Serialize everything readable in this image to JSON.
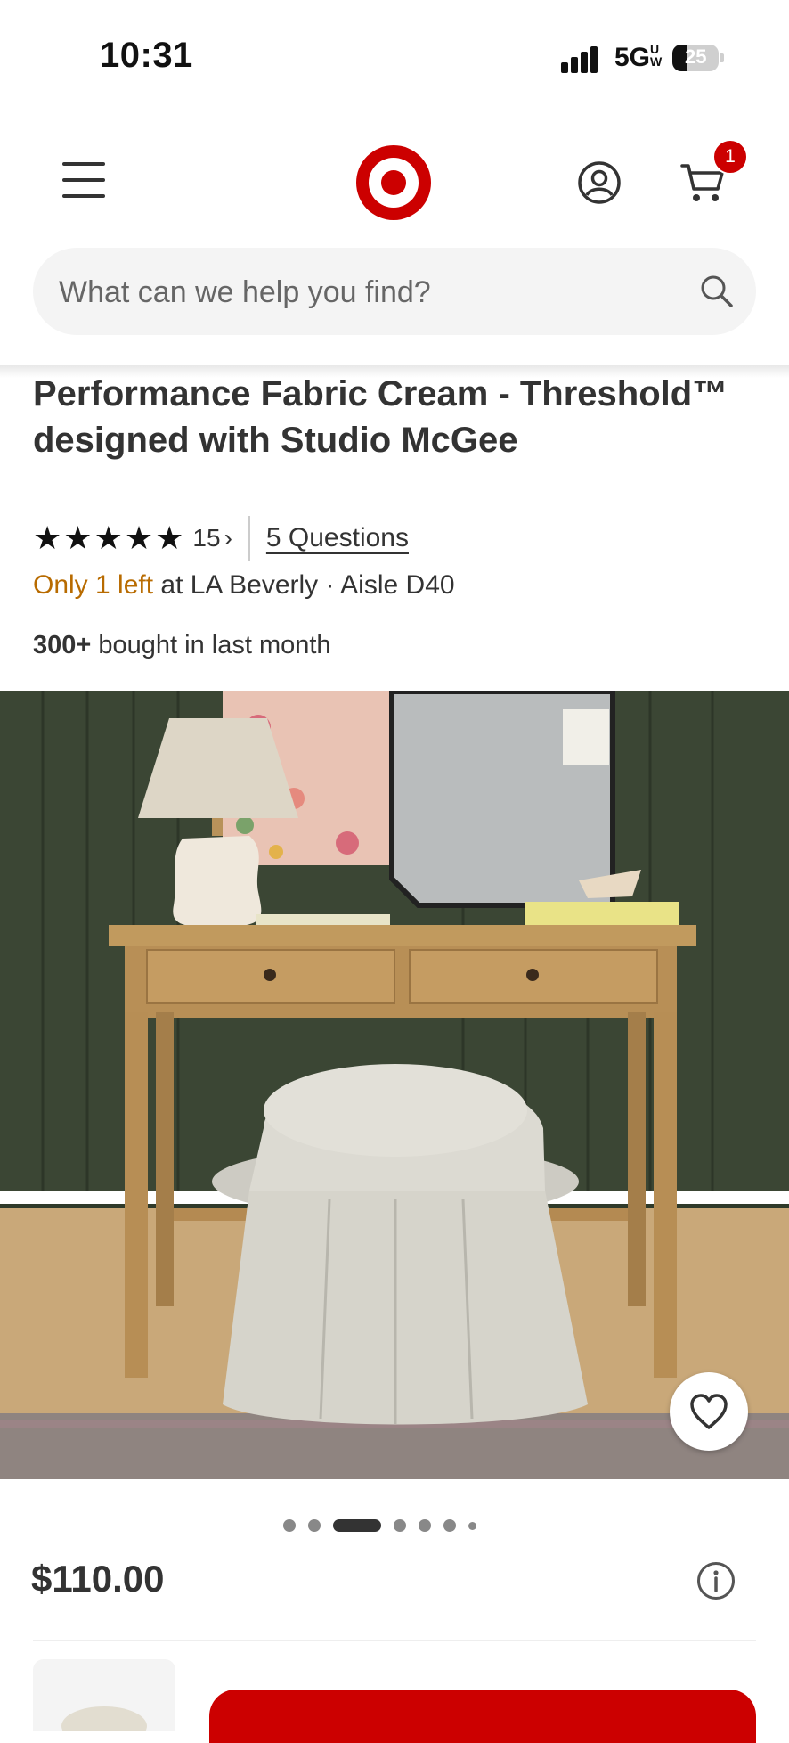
{
  "status_bar": {
    "time": "10:31",
    "network": "5G",
    "network_sub": "UW",
    "battery": "25"
  },
  "header": {
    "cart_count": "1",
    "search_placeholder": "What can we help you find?"
  },
  "product": {
    "title": "Performance Fabric Cream - Threshold™ designed with Studio McGee",
    "rating_stars": 5,
    "rating_count": "15",
    "questions_label": "5 Questions",
    "stock_warning": "Only 1 left",
    "stock_location": " at LA Beverly · Aisle D40",
    "bought_count": "300+",
    "bought_text": " bought in last month",
    "price": "$110.00",
    "carousel_pages": 7,
    "carousel_active": 2
  },
  "colors": {
    "brand_red": "#cc0000",
    "stock_orange": "#b86b00"
  }
}
